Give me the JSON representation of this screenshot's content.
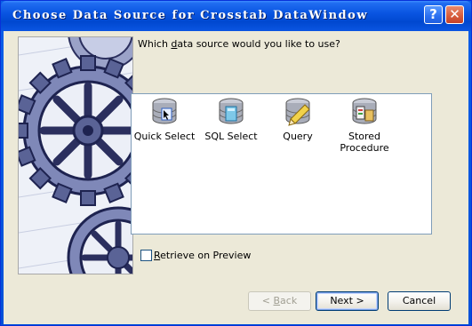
{
  "window": {
    "title": "Choose Data Source for Crosstab DataWindow",
    "help_label": "?",
    "close_label": "✕"
  },
  "question": {
    "pre": "Which ",
    "accel": "d",
    "post": "ata source would you like to use?"
  },
  "sources": [
    {
      "label": "Quick Select",
      "icon": "database-cursor-icon"
    },
    {
      "label": "SQL Select",
      "icon": "database-sql-icon"
    },
    {
      "label": "Query",
      "icon": "database-pencil-icon"
    },
    {
      "label": "Stored Procedure",
      "icon": "database-procedure-icon"
    }
  ],
  "retrieve": {
    "pre": "",
    "accel": "R",
    "post": "etrieve on Preview",
    "checked": false
  },
  "buttons": {
    "back": {
      "pre": "< ",
      "accel": "B",
      "post": "ack"
    },
    "next": "Next >",
    "cancel": "Cancel"
  }
}
